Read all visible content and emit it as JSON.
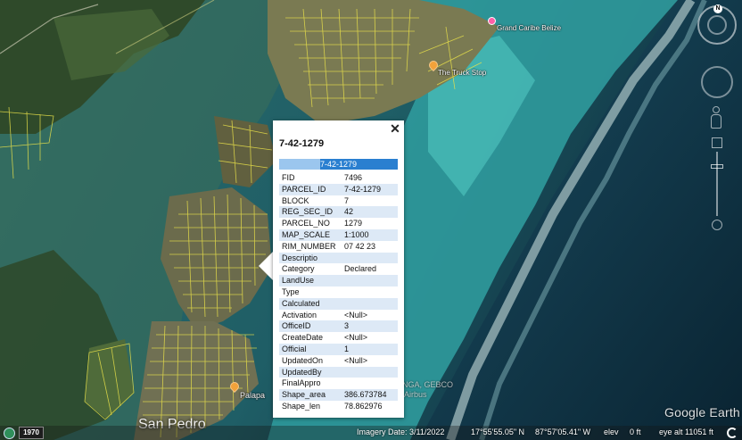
{
  "map": {
    "places": {
      "grand_caribe": "Grand Caribe Belize",
      "truck_stop": "The Truck Stop",
      "palapa": "Palapa",
      "san_pedro": "San Pedro"
    },
    "attribution": "NGA, GEBCO",
    "attribution2": "Airbus"
  },
  "popup": {
    "title": "7-42-1279",
    "header_value": "7-42-1279",
    "close_glyph": "✕",
    "attributes": [
      {
        "key": "FID",
        "value": "7496"
      },
      {
        "key": "PARCEL_ID",
        "value": "7-42-1279"
      },
      {
        "key": "BLOCK",
        "value": "7"
      },
      {
        "key": "REG_SEC_ID",
        "value": "42"
      },
      {
        "key": "PARCEL_NO",
        "value": "1279"
      },
      {
        "key": "MAP_SCALE",
        "value": "1:1000"
      },
      {
        "key": "RIM_NUMBER",
        "value": "07 42 23"
      },
      {
        "key": "Descriptio",
        "value": ""
      },
      {
        "key": "Category",
        "value": "Declared"
      },
      {
        "key": "LandUse",
        "value": ""
      },
      {
        "key": "Type",
        "value": ""
      },
      {
        "key": "Calculated",
        "value": ""
      },
      {
        "key": "Activation",
        "value": "<Null>"
      },
      {
        "key": "OfficeID",
        "value": "3"
      },
      {
        "key": "CreateDate",
        "value": "<Null>"
      },
      {
        "key": "Official",
        "value": "1"
      },
      {
        "key": "UpdatedOn",
        "value": "<Null>"
      },
      {
        "key": "UpdatedBy",
        "value": ""
      },
      {
        "key": "FinalAppro",
        "value": ""
      },
      {
        "key": "Shape_area",
        "value": "386.673784"
      },
      {
        "key": "Shape_len",
        "value": "78.862976"
      }
    ]
  },
  "nav": {
    "compass_label": "N"
  },
  "brand": {
    "logo_text": "Google Earth"
  },
  "status": {
    "year": "1970",
    "imagery_date": "Imagery Date: 3/11/2022",
    "lat": "17°55'55.05\" N",
    "lon": "87°57'05.41\" W",
    "elev_label": "elev",
    "elev_value": "0 ft",
    "eye_alt": "eye alt  11051 ft"
  },
  "colors": {
    "parcel_lines": "#e8e04a",
    "popup_header": "#2a7fd0",
    "row_alt": "#dde9f6"
  }
}
